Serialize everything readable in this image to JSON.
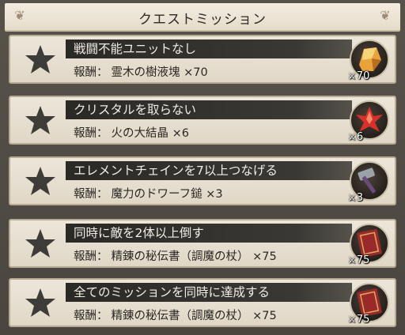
{
  "header": {
    "title": "クエストミッション"
  },
  "reward_prefix": "報酬：",
  "missions": [
    {
      "name": "戦闘不能ユニットなし",
      "reward_item": "霊木の樹液塊",
      "reward_qty": "×70",
      "badge_qty": "70",
      "icon": "amber-crystal-icon"
    },
    {
      "name": "クリスタルを取らない",
      "reward_item": "火の大結晶",
      "reward_qty": "×6",
      "badge_qty": "6",
      "icon": "fire-crystal-icon"
    },
    {
      "name": "エレメントチェインを7以上つなげる",
      "reward_item": "魔力のドワーフ鎚",
      "reward_qty": "×3",
      "badge_qty": "3",
      "icon": "dwarf-hammer-icon"
    },
    {
      "name": "同時に敵を2体以上倒す",
      "reward_item": "精錬の秘伝書（調魔の杖）",
      "reward_qty": "×75",
      "badge_qty": "75",
      "icon": "secret-book-icon"
    },
    {
      "name": "全てのミッションを同時に達成する",
      "reward_item": "精錬の秘伝書（調魔の杖）",
      "reward_qty": "×75",
      "badge_qty": "75",
      "icon": "secret-book-icon"
    }
  ]
}
